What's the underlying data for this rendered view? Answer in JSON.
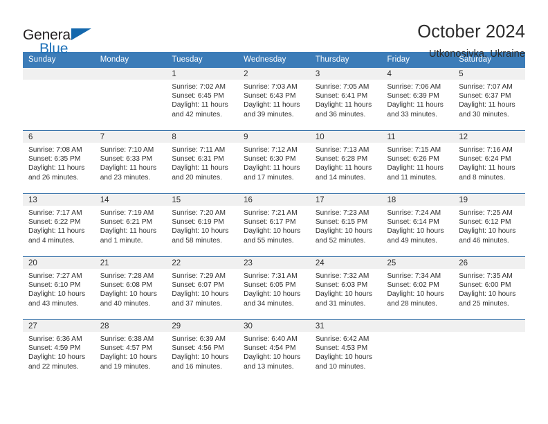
{
  "brand": {
    "name_top": "General",
    "name_bottom": "Blue",
    "flag_icon": "triangle-flag-icon",
    "accent_color": "#1468ad"
  },
  "header": {
    "title": "October 2024",
    "subtitle": "Utkonosivka, Ukraine"
  },
  "calendar": {
    "header_bg": "#3c7cb8",
    "row_separator_color": "#2f6ca5",
    "daynum_band_color": "#f0f0f0",
    "weekday_headers": [
      "Sunday",
      "Monday",
      "Tuesday",
      "Wednesday",
      "Thursday",
      "Friday",
      "Saturday"
    ],
    "weeks": [
      [
        {
          "day": "",
          "lines": []
        },
        {
          "day": "",
          "lines": []
        },
        {
          "day": "1",
          "lines": [
            "Sunrise: 7:02 AM",
            "Sunset: 6:45 PM",
            "Daylight: 11 hours",
            "and 42 minutes."
          ]
        },
        {
          "day": "2",
          "lines": [
            "Sunrise: 7:03 AM",
            "Sunset: 6:43 PM",
            "Daylight: 11 hours",
            "and 39 minutes."
          ]
        },
        {
          "day": "3",
          "lines": [
            "Sunrise: 7:05 AM",
            "Sunset: 6:41 PM",
            "Daylight: 11 hours",
            "and 36 minutes."
          ]
        },
        {
          "day": "4",
          "lines": [
            "Sunrise: 7:06 AM",
            "Sunset: 6:39 PM",
            "Daylight: 11 hours",
            "and 33 minutes."
          ]
        },
        {
          "day": "5",
          "lines": [
            "Sunrise: 7:07 AM",
            "Sunset: 6:37 PM",
            "Daylight: 11 hours",
            "and 30 minutes."
          ]
        }
      ],
      [
        {
          "day": "6",
          "lines": [
            "Sunrise: 7:08 AM",
            "Sunset: 6:35 PM",
            "Daylight: 11 hours",
            "and 26 minutes."
          ]
        },
        {
          "day": "7",
          "lines": [
            "Sunrise: 7:10 AM",
            "Sunset: 6:33 PM",
            "Daylight: 11 hours",
            "and 23 minutes."
          ]
        },
        {
          "day": "8",
          "lines": [
            "Sunrise: 7:11 AM",
            "Sunset: 6:31 PM",
            "Daylight: 11 hours",
            "and 20 minutes."
          ]
        },
        {
          "day": "9",
          "lines": [
            "Sunrise: 7:12 AM",
            "Sunset: 6:30 PM",
            "Daylight: 11 hours",
            "and 17 minutes."
          ]
        },
        {
          "day": "10",
          "lines": [
            "Sunrise: 7:13 AM",
            "Sunset: 6:28 PM",
            "Daylight: 11 hours",
            "and 14 minutes."
          ]
        },
        {
          "day": "11",
          "lines": [
            "Sunrise: 7:15 AM",
            "Sunset: 6:26 PM",
            "Daylight: 11 hours",
            "and 11 minutes."
          ]
        },
        {
          "day": "12",
          "lines": [
            "Sunrise: 7:16 AM",
            "Sunset: 6:24 PM",
            "Daylight: 11 hours",
            "and 8 minutes."
          ]
        }
      ],
      [
        {
          "day": "13",
          "lines": [
            "Sunrise: 7:17 AM",
            "Sunset: 6:22 PM",
            "Daylight: 11 hours",
            "and 4 minutes."
          ]
        },
        {
          "day": "14",
          "lines": [
            "Sunrise: 7:19 AM",
            "Sunset: 6:21 PM",
            "Daylight: 11 hours",
            "and 1 minute."
          ]
        },
        {
          "day": "15",
          "lines": [
            "Sunrise: 7:20 AM",
            "Sunset: 6:19 PM",
            "Daylight: 10 hours",
            "and 58 minutes."
          ]
        },
        {
          "day": "16",
          "lines": [
            "Sunrise: 7:21 AM",
            "Sunset: 6:17 PM",
            "Daylight: 10 hours",
            "and 55 minutes."
          ]
        },
        {
          "day": "17",
          "lines": [
            "Sunrise: 7:23 AM",
            "Sunset: 6:15 PM",
            "Daylight: 10 hours",
            "and 52 minutes."
          ]
        },
        {
          "day": "18",
          "lines": [
            "Sunrise: 7:24 AM",
            "Sunset: 6:14 PM",
            "Daylight: 10 hours",
            "and 49 minutes."
          ]
        },
        {
          "day": "19",
          "lines": [
            "Sunrise: 7:25 AM",
            "Sunset: 6:12 PM",
            "Daylight: 10 hours",
            "and 46 minutes."
          ]
        }
      ],
      [
        {
          "day": "20",
          "lines": [
            "Sunrise: 7:27 AM",
            "Sunset: 6:10 PM",
            "Daylight: 10 hours",
            "and 43 minutes."
          ]
        },
        {
          "day": "21",
          "lines": [
            "Sunrise: 7:28 AM",
            "Sunset: 6:08 PM",
            "Daylight: 10 hours",
            "and 40 minutes."
          ]
        },
        {
          "day": "22",
          "lines": [
            "Sunrise: 7:29 AM",
            "Sunset: 6:07 PM",
            "Daylight: 10 hours",
            "and 37 minutes."
          ]
        },
        {
          "day": "23",
          "lines": [
            "Sunrise: 7:31 AM",
            "Sunset: 6:05 PM",
            "Daylight: 10 hours",
            "and 34 minutes."
          ]
        },
        {
          "day": "24",
          "lines": [
            "Sunrise: 7:32 AM",
            "Sunset: 6:03 PM",
            "Daylight: 10 hours",
            "and 31 minutes."
          ]
        },
        {
          "day": "25",
          "lines": [
            "Sunrise: 7:34 AM",
            "Sunset: 6:02 PM",
            "Daylight: 10 hours",
            "and 28 minutes."
          ]
        },
        {
          "day": "26",
          "lines": [
            "Sunrise: 7:35 AM",
            "Sunset: 6:00 PM",
            "Daylight: 10 hours",
            "and 25 minutes."
          ]
        }
      ],
      [
        {
          "day": "27",
          "lines": [
            "Sunrise: 6:36 AM",
            "Sunset: 4:59 PM",
            "Daylight: 10 hours",
            "and 22 minutes."
          ]
        },
        {
          "day": "28",
          "lines": [
            "Sunrise: 6:38 AM",
            "Sunset: 4:57 PM",
            "Daylight: 10 hours",
            "and 19 minutes."
          ]
        },
        {
          "day": "29",
          "lines": [
            "Sunrise: 6:39 AM",
            "Sunset: 4:56 PM",
            "Daylight: 10 hours",
            "and 16 minutes."
          ]
        },
        {
          "day": "30",
          "lines": [
            "Sunrise: 6:40 AM",
            "Sunset: 4:54 PM",
            "Daylight: 10 hours",
            "and 13 minutes."
          ]
        },
        {
          "day": "31",
          "lines": [
            "Sunrise: 6:42 AM",
            "Sunset: 4:53 PM",
            "Daylight: 10 hours",
            "and 10 minutes."
          ]
        },
        {
          "day": "",
          "lines": []
        },
        {
          "day": "",
          "lines": []
        }
      ]
    ]
  }
}
